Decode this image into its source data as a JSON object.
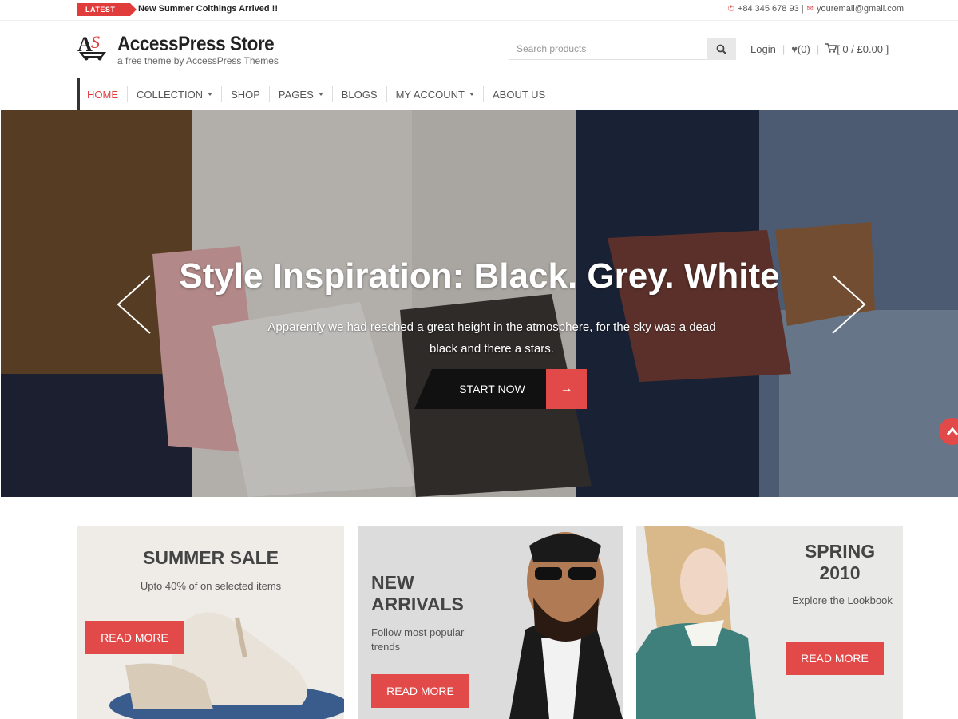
{
  "topbar": {
    "latest_label": "LATEST",
    "news": "New Summer Colthings Arrived !!",
    "phone": "+84 345 678 93 |",
    "email": "youremail@gmail.com"
  },
  "header": {
    "title": "AccessPress Store",
    "tagline": "a free theme by AccessPress Themes",
    "search_placeholder": "Search products",
    "login": "Login",
    "wishlist_count": "(0)",
    "cart": "[ 0 / £0.00 ]"
  },
  "nav": {
    "items": [
      {
        "label": "HOME",
        "active": true
      },
      {
        "label": "COLLECTION",
        "dropdown": true
      },
      {
        "label": "SHOP"
      },
      {
        "label": "PAGES",
        "dropdown": true
      },
      {
        "label": "BLOGS"
      },
      {
        "label": "MY ACCOUNT",
        "dropdown": true
      },
      {
        "label": "ABOUT US"
      }
    ]
  },
  "hero": {
    "title": "Style Inspiration: Black. Grey. White",
    "subtitle": "Apparently we had reached a great height in the atmosphere, for the sky was a dead black and there a stars.",
    "button": "START NOW"
  },
  "promos": [
    {
      "title": "SUMMER SALE",
      "subtitle": "Upto 40% of on selected items",
      "button": "READ MORE"
    },
    {
      "title_line1": "NEW",
      "title_line2": "ARRIVALS",
      "subtitle": "Follow most popular trends",
      "button": "READ MORE"
    },
    {
      "title_line1": "SPRING",
      "title_line2": "2010",
      "subtitle": "Explore the Lookbook",
      "button": "READ MORE"
    }
  ],
  "colors": {
    "accent": "#e03c3c",
    "button": "#e24a4a",
    "dark": "#111111"
  },
  "icons": [
    "phone-icon",
    "mail-icon",
    "search-icon",
    "heart-icon",
    "cart-icon",
    "chevron-left-icon",
    "chevron-right-icon",
    "arrow-right-icon",
    "scroll-top-icon"
  ]
}
